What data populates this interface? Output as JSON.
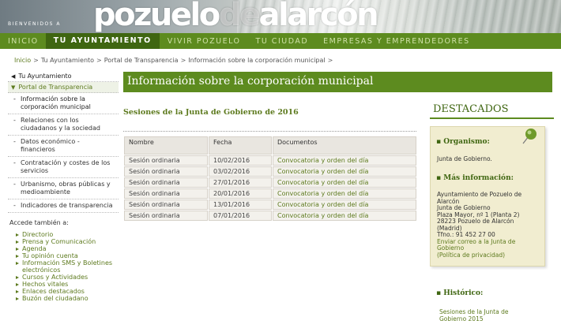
{
  "header": {
    "welcome": "BIENVENIDOS A",
    "logo_main": "pozuelo",
    "logo_de": "de",
    "logo_end": "alarcón"
  },
  "nav": {
    "items": [
      "INICIO",
      "TU AYUNTAMIENTO",
      "VIVIR POZUELO",
      "TU CIUDAD",
      "EMPRESAS Y EMPRENDEDORES"
    ]
  },
  "breadcrumb": {
    "items": [
      "Inicio",
      "Tu Ayuntamiento",
      "Portal de Transparencia",
      "Información sobre la corporación municipal"
    ],
    "sep": ">"
  },
  "sidebar": {
    "head": "Tu Ayuntamiento",
    "sub": "Portal de Transparencia",
    "items": [
      "Información sobre la corporación municipal",
      "Relaciones con los ciudadanos y la sociedad",
      "Datos económico - financieros",
      "Contratación y costes de los servicios",
      "Urbanismo, obras públicas y medioambiente",
      "Indicadores de transparencia"
    ],
    "also_title": "Accede también a:",
    "also_items": [
      "Directorio",
      "Prensa y Comunicación",
      "Agenda",
      "Tu opinión cuenta",
      "Información SMS y Boletines electrónicos",
      "Cursos y Actividades",
      "Hechos vitales",
      "Enlaces destacados",
      "Buzón del ciudadano"
    ]
  },
  "main": {
    "title": "Información sobre la corporación municipal",
    "section": "Sesiones de la Junta de Gobierno de 2016",
    "columns": [
      "Nombre",
      "Fecha",
      "Documentos"
    ],
    "rows": [
      [
        "Sesión ordinaria",
        "10/02/2016",
        "Convocatoria y orden del día"
      ],
      [
        "Sesión ordinaria",
        "03/02/2016",
        "Convocatoria y orden del día"
      ],
      [
        "Sesión ordinaria",
        "27/01/2016",
        "Convocatoria y orden del día"
      ],
      [
        "Sesión ordinaria",
        "20/01/2016",
        "Convocatoria y orden del día"
      ],
      [
        "Sesión ordinaria",
        "13/01/2016",
        "Convocatoria y orden del día"
      ],
      [
        "Sesión ordinaria",
        "07/01/2016",
        "Convocatoria y orden del día"
      ]
    ]
  },
  "destacados": {
    "title": "DESTACADOS",
    "org_h": "Organismo:",
    "org_v": "Junta de Gobierno.",
    "inf_h": "Más información:",
    "inf_lines": [
      "Ayuntamiento de Pozuelo de Alarcón",
      "Junta de Gobierno",
      "Plaza Mayor, nº 1 (Planta 2)",
      "28223 Pozuelo de Alarcón (Madrid)",
      "Tfno.: 91 452 27 00"
    ],
    "inf_link": "Enviar correo a la Junta de Gobierno",
    "inf_privacy": "(Política de privacidad)",
    "hist_h": "Histórico:",
    "hist_v": "Sesiones de la Junta de Gobierno 2015"
  }
}
